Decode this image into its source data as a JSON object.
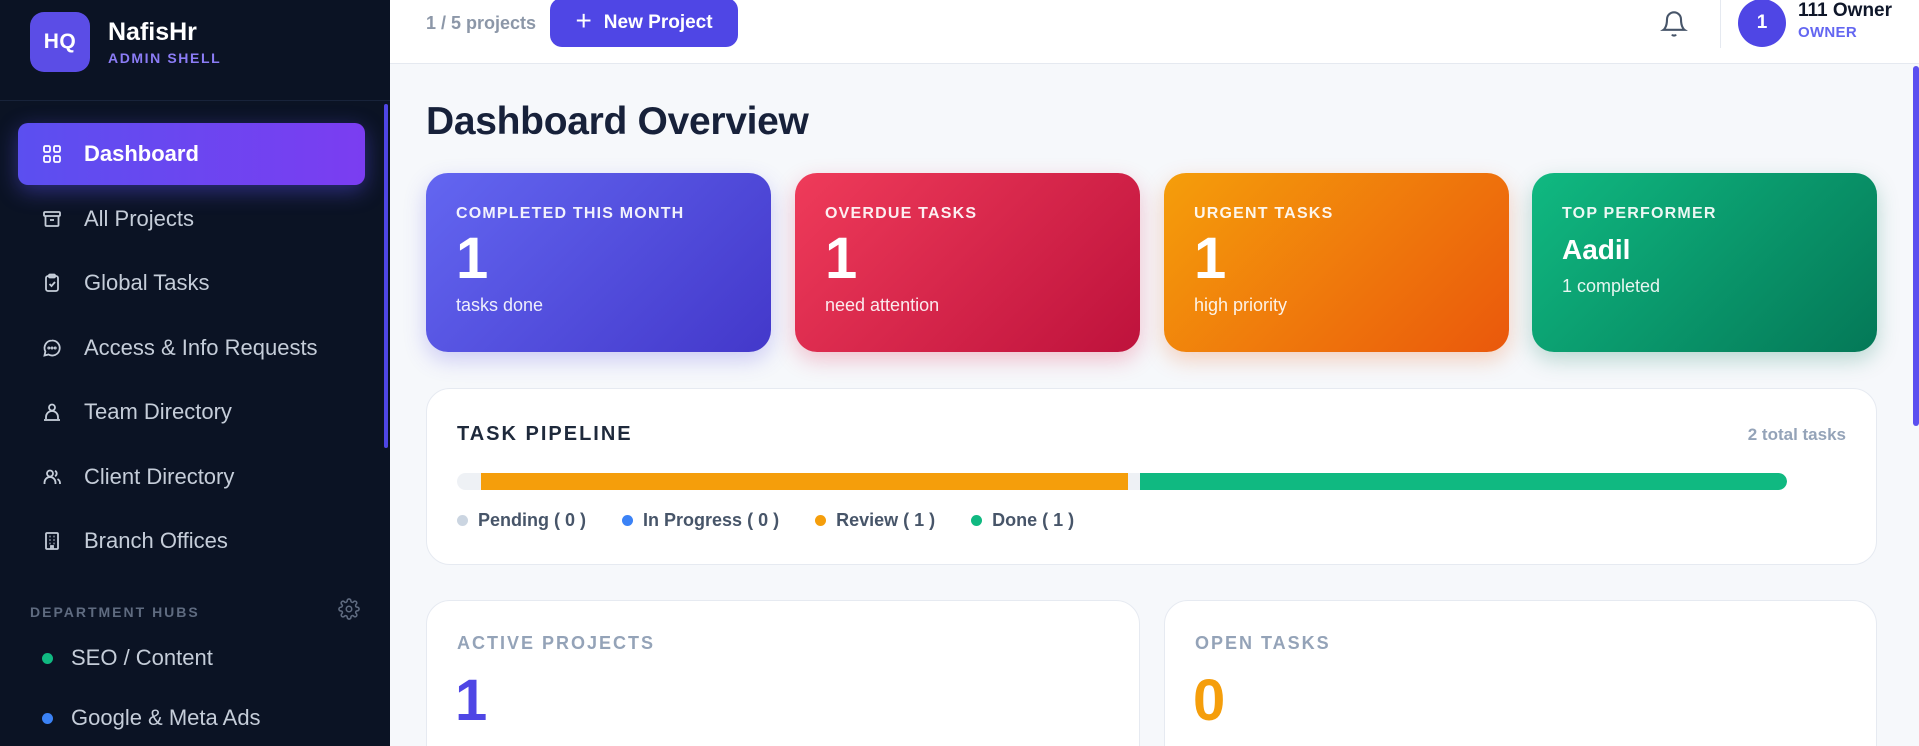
{
  "brand": {
    "logo_text": "HQ",
    "name": "NafisHr",
    "subtitle": "ADMIN SHELL"
  },
  "sidebar": {
    "nav": [
      {
        "label": "Dashboard",
        "icon": "grid-icon",
        "active": true
      },
      {
        "label": "All Projects",
        "icon": "archive-icon",
        "active": false
      },
      {
        "label": "Global Tasks",
        "icon": "clipboard-icon",
        "active": false
      },
      {
        "label": "Access & Info Requests",
        "icon": "chat-icon",
        "active": false
      },
      {
        "label": "Team Directory",
        "icon": "user-network-icon",
        "active": false
      },
      {
        "label": "Client Directory",
        "icon": "users-icon",
        "active": false
      },
      {
        "label": "Branch Offices",
        "icon": "building-icon",
        "active": false
      }
    ],
    "department_title": "DEPARTMENT HUBS",
    "departments": [
      {
        "label": "SEO / Content",
        "color": "#10b981"
      },
      {
        "label": "Google & Meta Ads",
        "color": "#3b82f6"
      }
    ]
  },
  "topbar": {
    "project_count": "1 / 5 projects",
    "new_project_label": "New Project",
    "user": {
      "initial": "1",
      "name": "111 Owner",
      "role": "OWNER"
    }
  },
  "page": {
    "title": "Dashboard Overview"
  },
  "stats": [
    {
      "label": "COMPLETED THIS MONTH",
      "value": "1",
      "sub": "tasks done",
      "color_from": "#6366f1",
      "color_to": "#4338ca"
    },
    {
      "label": "OVERDUE TASKS",
      "value": "1",
      "sub": "need attention",
      "color_from": "#ef3b5a",
      "color_to": "#be123c"
    },
    {
      "label": "URGENT TASKS",
      "value": "1",
      "sub": "high priority",
      "color_from": "#f59e0b",
      "color_to": "#ea580c"
    },
    {
      "label": "TOP PERFORMER",
      "name": "Aadil",
      "sub": "1 completed",
      "color_from": "#10b981",
      "color_to": "#047857"
    }
  ],
  "pipeline": {
    "title": "TASK PIPELINE",
    "total_label": "2 total tasks",
    "segments": [
      {
        "label": "Pending",
        "count": "0",
        "color": "#cbd5e1"
      },
      {
        "label": "In Progress",
        "count": "0",
        "color": "#3b82f6"
      },
      {
        "label": "Review",
        "count": "1",
        "color": "#f59e0b"
      },
      {
        "label": "Done",
        "count": "1",
        "color": "#10b981"
      }
    ]
  },
  "metrics": [
    {
      "label": "ACTIVE PROJECTS",
      "value": "1",
      "color": "#4f46e5"
    },
    {
      "label": "OPEN TASKS",
      "value": "0",
      "color": "#f59e0b"
    }
  ]
}
